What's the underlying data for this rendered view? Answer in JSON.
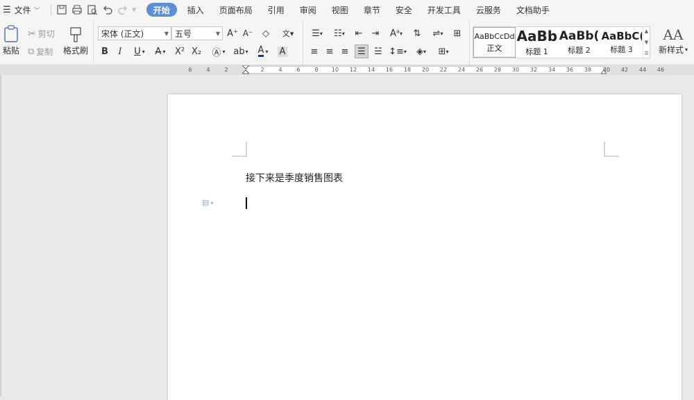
{
  "menubar": {
    "file_label": "文件",
    "tabs": [
      {
        "label": "开始",
        "active": true
      },
      {
        "label": "插入"
      },
      {
        "label": "页面布局"
      },
      {
        "label": "引用"
      },
      {
        "label": "审阅"
      },
      {
        "label": "视图"
      },
      {
        "label": "章节"
      },
      {
        "label": "安全"
      },
      {
        "label": "开发工具"
      },
      {
        "label": "云服务"
      },
      {
        "label": "文档助手"
      }
    ],
    "active_color": "#5b8fd6"
  },
  "clipboard": {
    "paste_label": "粘贴",
    "cut_label": "剪切",
    "copy_label": "复制",
    "format_painter_label": "格式刷"
  },
  "font": {
    "family_value": "宋体 (正文)",
    "size_value": "五号"
  },
  "styles": {
    "items": [
      {
        "preview": "AaBbCcDd",
        "name": "正文"
      },
      {
        "preview": "AaBb",
        "name": "标题 1"
      },
      {
        "preview": "AaBb(",
        "name": "标题 2"
      },
      {
        "preview": "AaBbC(",
        "name": "标题 3"
      }
    ],
    "new_style_label": "新样式"
  },
  "ruler": {
    "left_ticks": [
      "6",
      "4",
      "2"
    ],
    "right_ticks": [
      "2",
      "4",
      "6",
      "8",
      "10",
      "12",
      "14",
      "16",
      "18",
      "20",
      "22",
      "24",
      "26",
      "28",
      "30",
      "32",
      "34",
      "36",
      "38",
      "40",
      "42",
      "44",
      "46"
    ]
  },
  "document": {
    "text": "接下来是季度销售图表"
  }
}
